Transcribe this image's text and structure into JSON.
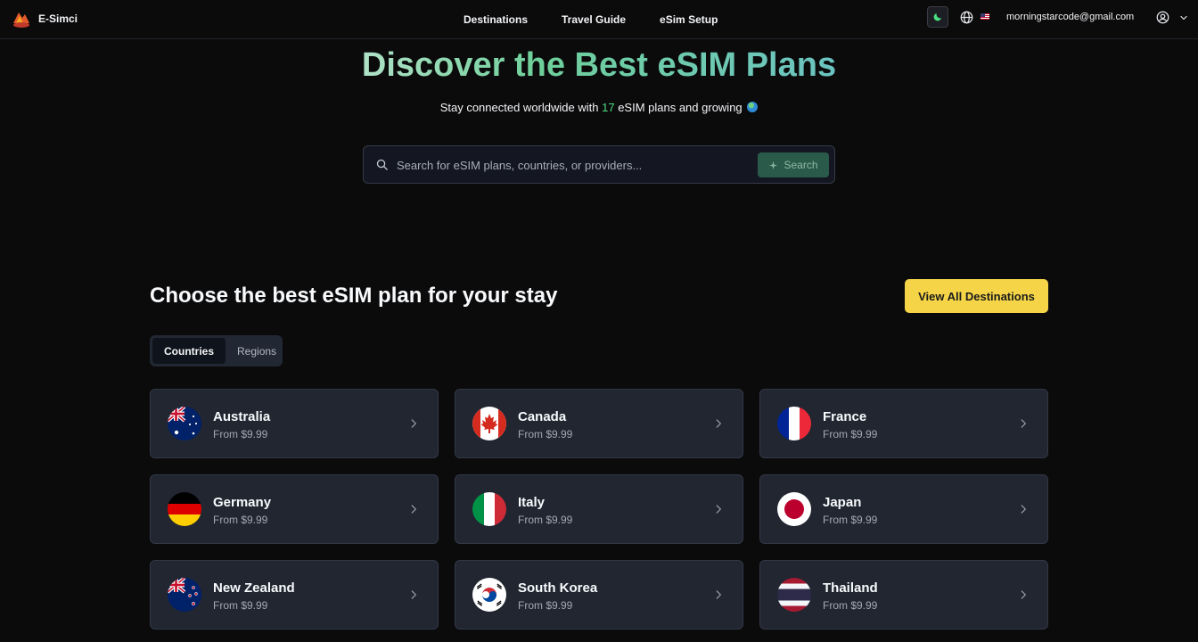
{
  "brand": {
    "name": "E-Simci"
  },
  "nav": {
    "links": [
      "Destinations",
      "Travel Guide",
      "eSim Setup"
    ],
    "user_email": "morningstarcode@gmail.com",
    "language_flag": "flag-us-icon"
  },
  "hero": {
    "title": "Discover the Best eSIM Plans",
    "subtitle_prefix": "Stay connected worldwide with",
    "plan_count": "17",
    "subtitle_suffix": "eSIM plans and growing"
  },
  "search": {
    "placeholder": "Search for eSIM plans, countries, or providers...",
    "value": "",
    "button_label": "Search"
  },
  "section": {
    "title": "Choose the best eSIM plan for your stay",
    "view_all_label": "View All Destinations",
    "tabs": [
      {
        "label": "Countries",
        "active": true
      },
      {
        "label": "Regions",
        "active": false
      }
    ]
  },
  "countries": [
    {
      "name": "Australia",
      "price": "From $9.99",
      "flag": "flag-australia-icon"
    },
    {
      "name": "Canada",
      "price": "From $9.99",
      "flag": "flag-canada-icon"
    },
    {
      "name": "France",
      "price": "From $9.99",
      "flag": "flag-france-icon"
    },
    {
      "name": "Germany",
      "price": "From $9.99",
      "flag": "flag-germany-icon"
    },
    {
      "name": "Italy",
      "price": "From $9.99",
      "flag": "flag-italy-icon"
    },
    {
      "name": "Japan",
      "price": "From $9.99",
      "flag": "flag-japan-icon"
    },
    {
      "name": "New Zealand",
      "price": "From $9.99",
      "flag": "flag-new-zealand-icon"
    },
    {
      "name": "South Korea",
      "price": "From $9.99",
      "flag": "flag-south-korea-icon"
    },
    {
      "name": "Thailand",
      "price": "From $9.99",
      "flag": "flag-thailand-icon"
    }
  ],
  "colors": {
    "background": "#0b0b0c",
    "card": "#212631",
    "accent_yellow": "#f5d547",
    "accent_green": "#4ade80",
    "search_button": "#2a5a4a"
  }
}
